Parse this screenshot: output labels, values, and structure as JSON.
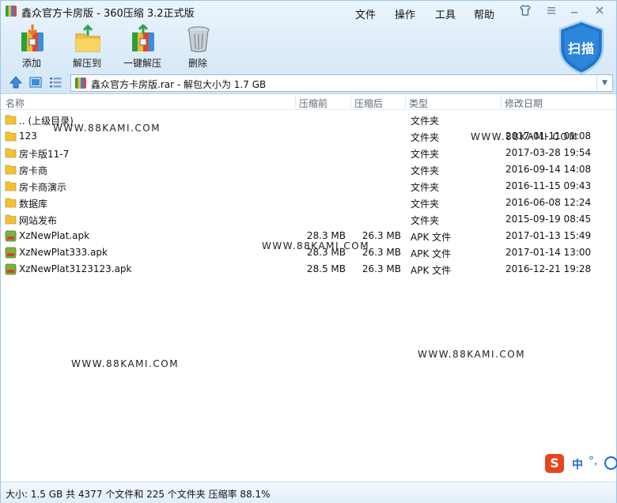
{
  "window": {
    "title": "鑫众官方卡房版 - 360压缩 3.2正式版"
  },
  "menu": {
    "file": "文件",
    "operate": "操作",
    "tools": "工具",
    "help": "帮助"
  },
  "toolbar": {
    "add": "添加",
    "extract_to": "解压到",
    "one_click_extract": "一键解压",
    "delete": "删除",
    "scan": "扫描"
  },
  "address": {
    "path": "鑫众官方卡房版.rar - 解包大小为 1.7 GB"
  },
  "columns": {
    "name": "名称",
    "compressed": "压缩前",
    "uncompressed": "压缩后",
    "type": "类型",
    "modified": "修改日期"
  },
  "files": [
    {
      "icon": "folder-up-icon",
      "name": ".. (上级目录)",
      "compressed": "",
      "uncompressed": "",
      "type": "文件夹",
      "modified": ""
    },
    {
      "icon": "folder-icon",
      "name": "123",
      "compressed": "",
      "uncompressed": "",
      "type": "文件夹",
      "modified": "2017-01-11 01:08"
    },
    {
      "icon": "folder-icon",
      "name": "房卡版11-7",
      "compressed": "",
      "uncompressed": "",
      "type": "文件夹",
      "modified": "2017-03-28 19:54"
    },
    {
      "icon": "folder-icon",
      "name": "房卡商",
      "compressed": "",
      "uncompressed": "",
      "type": "文件夹",
      "modified": "2016-09-14 14:08"
    },
    {
      "icon": "folder-icon",
      "name": "房卡商演示",
      "compressed": "",
      "uncompressed": "",
      "type": "文件夹",
      "modified": "2016-11-15 09:43"
    },
    {
      "icon": "folder-icon",
      "name": "数据库",
      "compressed": "",
      "uncompressed": "",
      "type": "文件夹",
      "modified": "2016-06-08 12:24"
    },
    {
      "icon": "folder-icon",
      "name": "网站发布",
      "compressed": "",
      "uncompressed": "",
      "type": "文件夹",
      "modified": "2015-09-19 08:45"
    },
    {
      "icon": "apk-icon",
      "name": "XzNewPlat.apk",
      "compressed": "28.3 MB",
      "uncompressed": "26.3 MB",
      "type": "APK 文件",
      "modified": "2017-01-13 15:49"
    },
    {
      "icon": "apk-icon",
      "name": "XzNewPlat333.apk",
      "compressed": "28.3 MB",
      "uncompressed": "26.3 MB",
      "type": "APK 文件",
      "modified": "2017-01-14 13:00"
    },
    {
      "icon": "apk-icon",
      "name": "XzNewPlat3123123.apk",
      "compressed": "28.5 MB",
      "uncompressed": "26.3 MB",
      "type": "APK 文件",
      "modified": "2016-12-21 19:28"
    }
  ],
  "watermarks": [
    "WWW.88KAMI.COM",
    "WWW.88KAMI.COM",
    "WWW.88KAMI.COM",
    "WWW.88KAMI.COM",
    "WWW.88KAMI.COM"
  ],
  "ime": {
    "logo": "S",
    "mode": "中",
    "punct": "°,"
  },
  "status": {
    "text": "大小: 1.5 GB 共 4377 个文件和 225 个文件夹 压缩率 88.1%"
  }
}
